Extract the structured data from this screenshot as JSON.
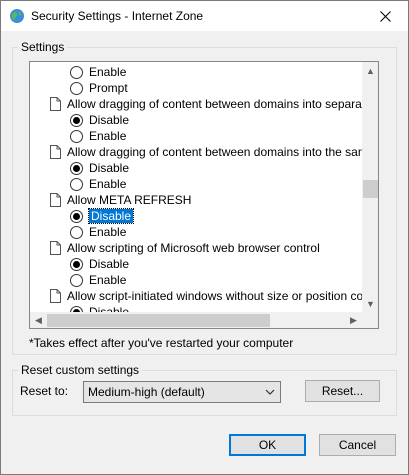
{
  "window": {
    "title": "Security Settings - Internet Zone",
    "close_icon": "close-icon",
    "app_icon": "globe-icon"
  },
  "settings_group": {
    "label": "Settings",
    "items": [
      {
        "kind": "option",
        "label": "Enable",
        "checked": false
      },
      {
        "kind": "option",
        "label": "Prompt",
        "checked": false
      },
      {
        "kind": "heading",
        "label": "Allow dragging of content between domains into separate wi"
      },
      {
        "kind": "option",
        "label": "Disable",
        "checked": true
      },
      {
        "kind": "option",
        "label": "Enable",
        "checked": false
      },
      {
        "kind": "heading",
        "label": "Allow dragging of content between domains into the same wi"
      },
      {
        "kind": "option",
        "label": "Disable",
        "checked": true
      },
      {
        "kind": "option",
        "label": "Enable",
        "checked": false
      },
      {
        "kind": "heading",
        "label": "Allow META REFRESH"
      },
      {
        "kind": "option",
        "label": "Disable",
        "checked": true,
        "selected": true
      },
      {
        "kind": "option",
        "label": "Enable",
        "checked": false
      },
      {
        "kind": "heading",
        "label": "Allow scripting of Microsoft web browser control"
      },
      {
        "kind": "option",
        "label": "Disable",
        "checked": true
      },
      {
        "kind": "option",
        "label": "Enable",
        "checked": false
      },
      {
        "kind": "heading",
        "label": "Allow script-initiated windows without size or position constra"
      },
      {
        "kind": "option",
        "label": "Disable",
        "checked": true
      }
    ],
    "note": "*Takes effect after you've restarted your computer"
  },
  "reset_group": {
    "label": "Reset custom settings",
    "reset_to_label": "Reset to:",
    "selected_level": "Medium-high (default)",
    "reset_button": "Reset..."
  },
  "footer": {
    "ok": "OK",
    "cancel": "Cancel"
  },
  "colors": {
    "accent": "#0078d7",
    "dialog_bg": "#f0f0f0"
  }
}
